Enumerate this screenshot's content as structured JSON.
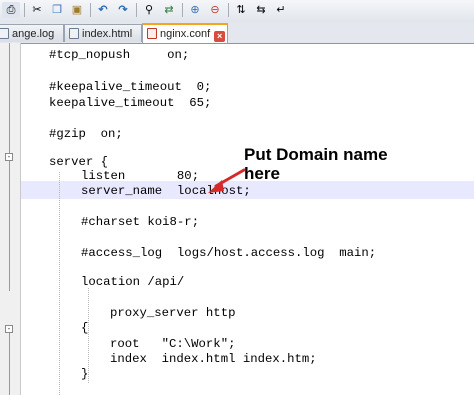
{
  "toolbar": {
    "icons": [
      "print-icon",
      "cut-icon",
      "copy-icon",
      "paste-icon",
      "undo-icon",
      "redo-icon",
      "find-icon",
      "replace-icon",
      "zoom-in-icon",
      "zoom-out-icon",
      "sync-vertical-icon",
      "sync-horizontal-icon",
      "word-wrap-icon"
    ]
  },
  "tabs": [
    {
      "label": "ange.log",
      "active": false
    },
    {
      "label": "index.html",
      "active": false
    },
    {
      "label": "nginx.conf",
      "active": true
    }
  ],
  "code": {
    "lines": [
      "#tcp_nopush     on;",
      "#keepalive_timeout  0;",
      "keepalive_timeout  65;",
      "#gzip  on;",
      "server {",
      "listen       80;",
      "server_name  localhost;",
      "#charset koi8-r;",
      "#access_log  logs/host.access.log  main;",
      "location /api/",
      "proxy_server http",
      "{",
      "root   \"C:\\Work\";",
      "index  index.html index.htm;",
      "}"
    ]
  },
  "annotation": {
    "text": "Put Domain name here",
    "color": "#d42a2a"
  },
  "colors": {
    "current_line": "#e8e8ff",
    "active_tab_accent": "#f7a41d"
  }
}
